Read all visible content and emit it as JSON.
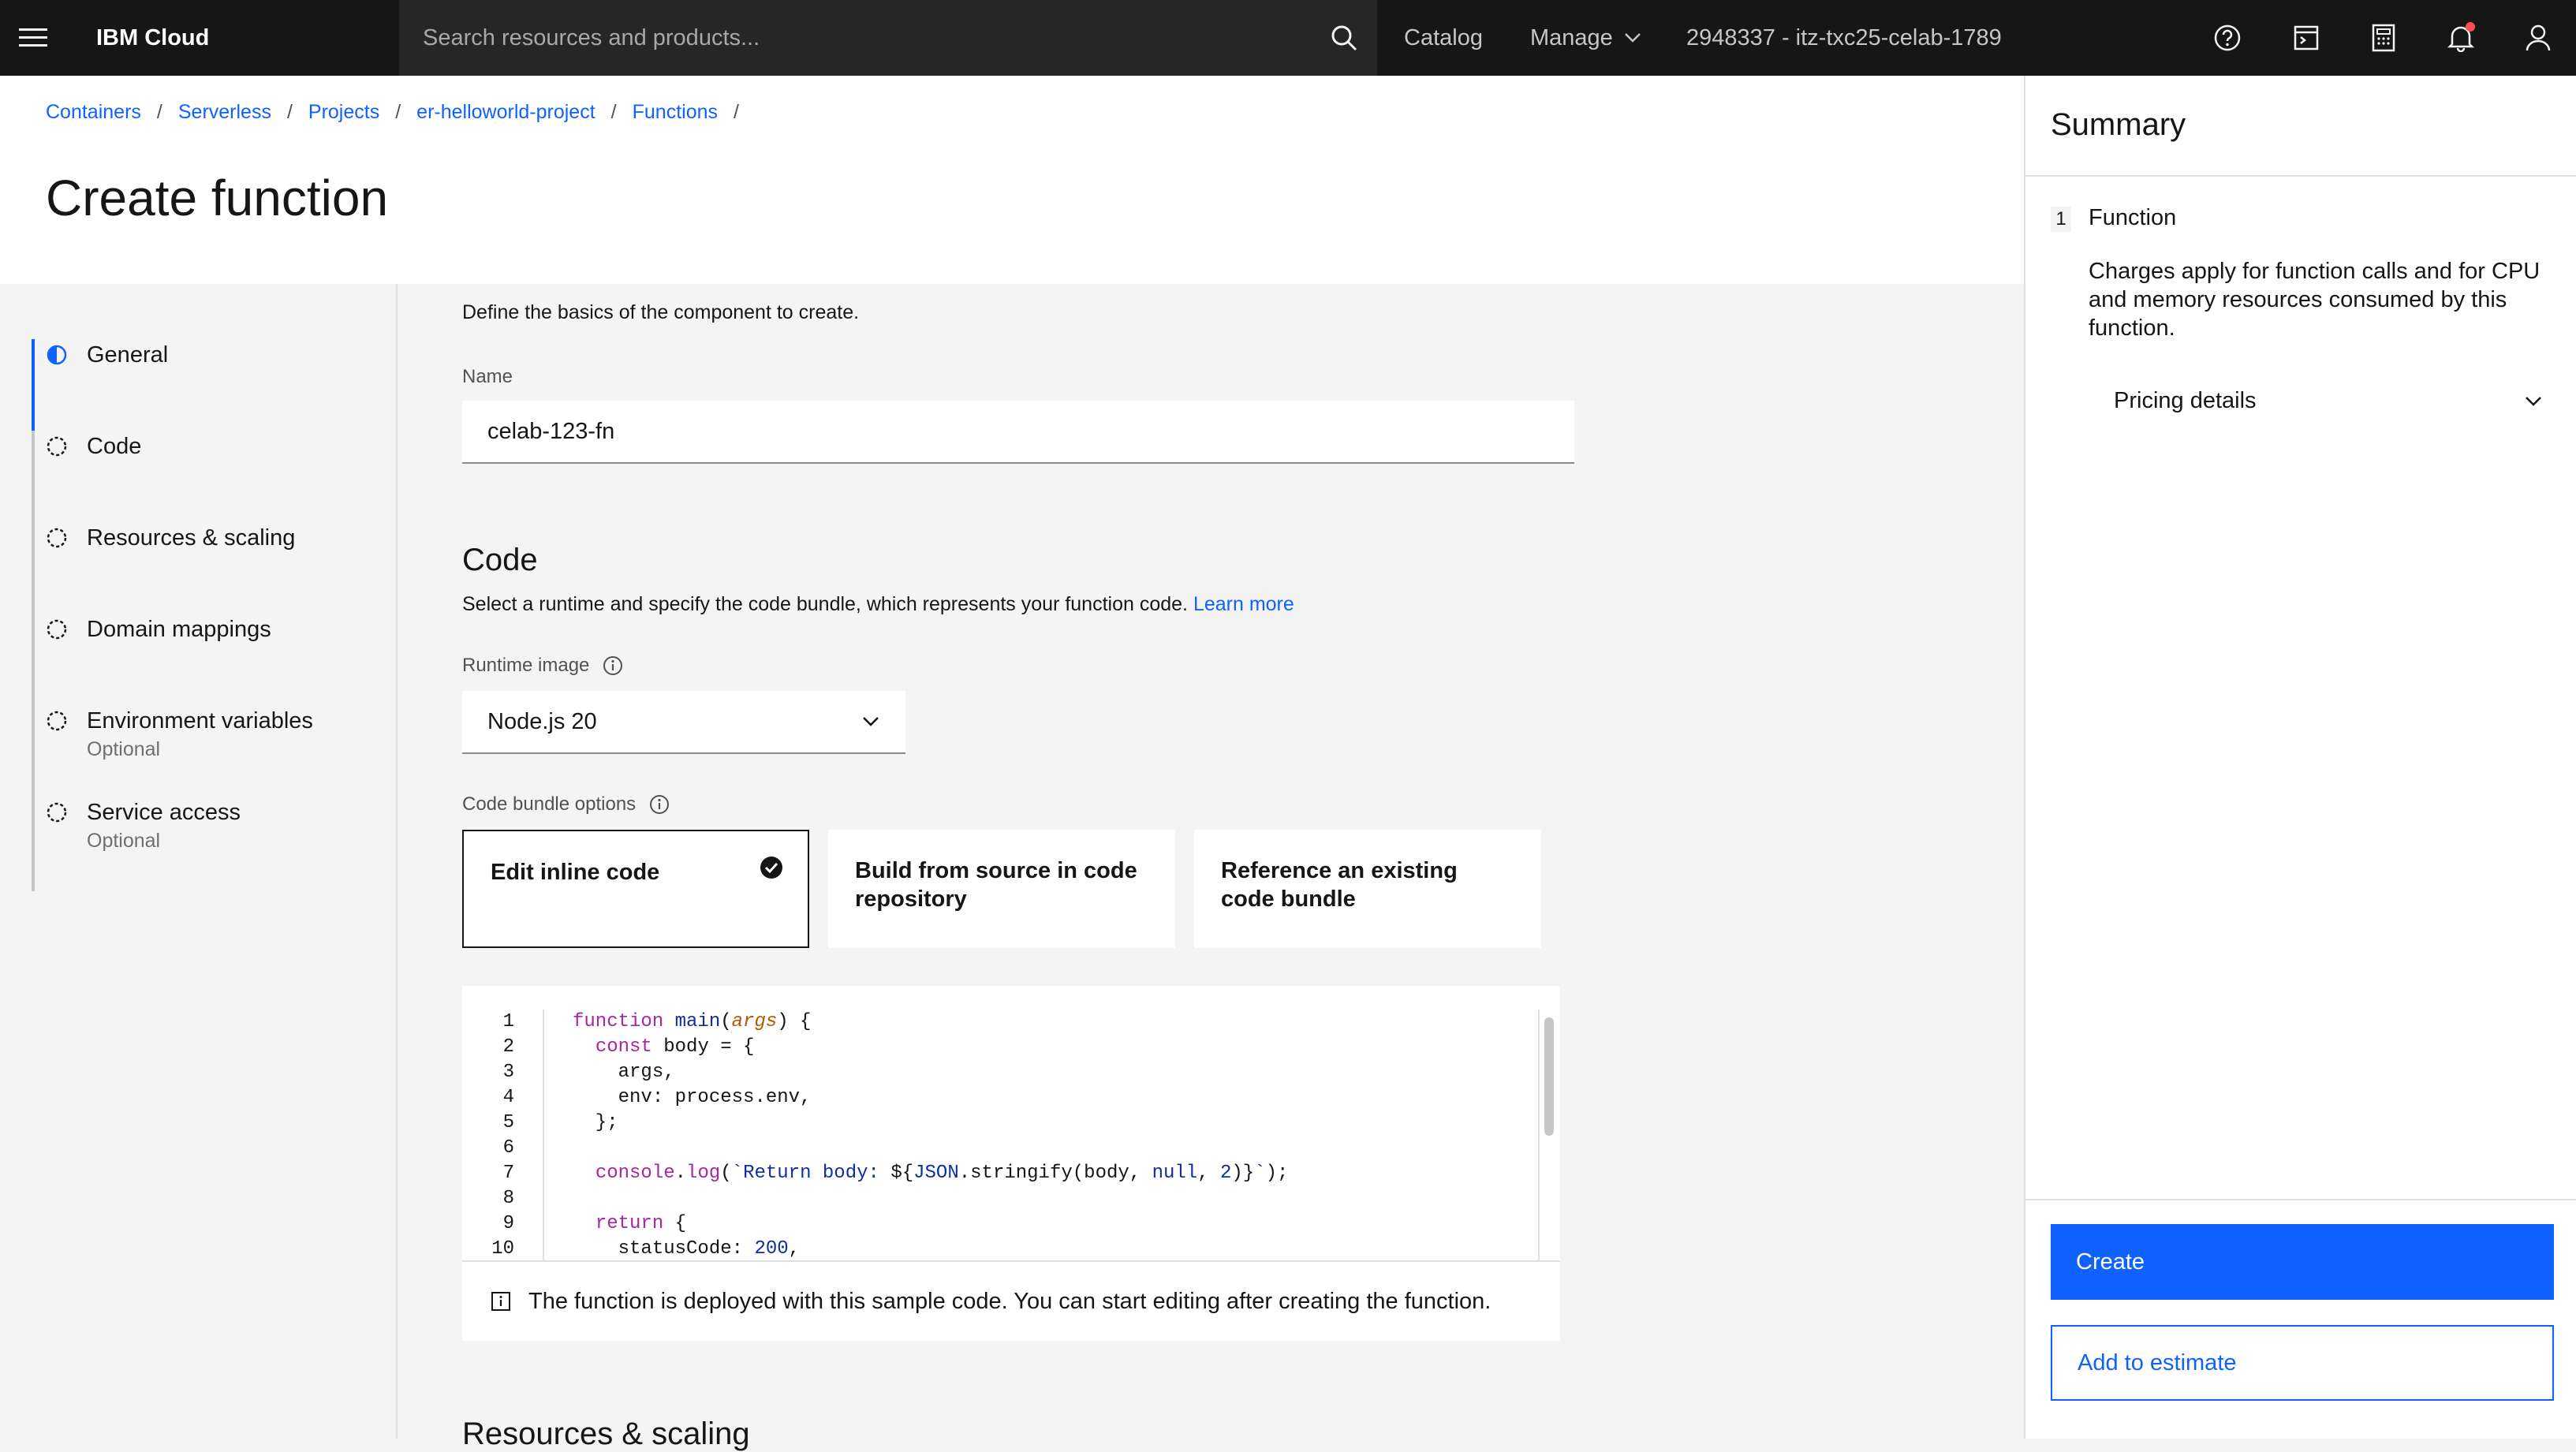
{
  "header": {
    "brand": "IBM Cloud",
    "search_placeholder": "Search resources and products...",
    "catalog": "Catalog",
    "manage": "Manage",
    "account": "2948337 - itz-txc25-celab-1789",
    "icons": [
      "menu-icon",
      "search-icon",
      "help-icon",
      "terminal-icon",
      "calculator-icon",
      "notification-icon",
      "user-icon"
    ]
  },
  "breadcrumb": [
    "Containers",
    "Serverless",
    "Projects",
    "er-helloworld-project",
    "Functions"
  ],
  "page_title": "Create function",
  "steps": [
    {
      "label": "General",
      "optional": ""
    },
    {
      "label": "Code",
      "optional": ""
    },
    {
      "label": "Resources & scaling",
      "optional": ""
    },
    {
      "label": "Domain mappings",
      "optional": ""
    },
    {
      "label": "Environment variables",
      "optional": "Optional"
    },
    {
      "label": "Service access",
      "optional": "Optional"
    }
  ],
  "general": {
    "intro": "Define the basics of the component to create.",
    "name_label": "Name",
    "name_value": "celab-123-fn"
  },
  "code": {
    "heading": "Code",
    "description": "Select a runtime and specify the code bundle, which represents your function code.",
    "learn_more": "Learn more",
    "runtime_label": "Runtime image",
    "runtime_value": "Node.js 20",
    "bundle_label": "Code bundle options",
    "tiles": [
      "Edit inline code",
      "Build from source in code repository",
      "Reference an existing code bundle"
    ],
    "line_numbers": [
      "1",
      "2",
      "3",
      "4",
      "5",
      "6",
      "7",
      "8",
      "9",
      "10"
    ],
    "notice": "The function is deployed with this sample code. You can start editing after creating the function."
  },
  "resources_heading": "Resources & scaling",
  "summary": {
    "title": "Summary",
    "step_number": "1",
    "step_name": "Function",
    "description": "Charges apply for function calls and for CPU and memory resources consumed by this function.",
    "pricing": "Pricing details",
    "create": "Create",
    "add_estimate": "Add to estimate"
  },
  "colors": {
    "primary": "#0f62fe",
    "header_bg": "#161616",
    "notification_dot": "#fa4d56"
  }
}
